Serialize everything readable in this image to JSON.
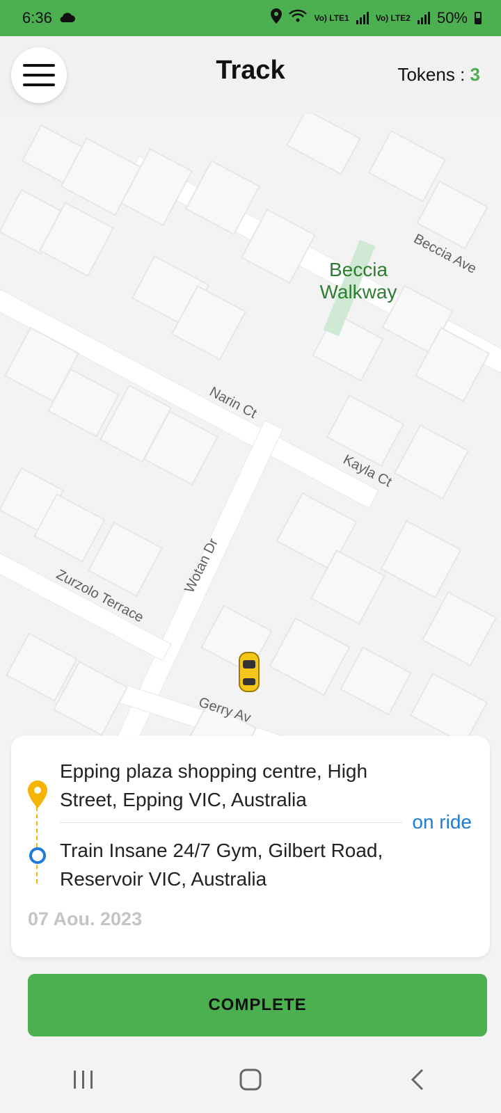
{
  "status_bar": {
    "time": "6:36",
    "lte1": "Vo) LTE1",
    "lte2": "Vo) LTE2",
    "battery": "50%"
  },
  "header": {
    "title": "Track",
    "tokens_label": "Tokens : ",
    "tokens_value": "3"
  },
  "map": {
    "place": "Beccia Walkway",
    "roads": [
      "Beccia Ave",
      "Narin Ct",
      "Kayla Ct",
      "Wotan Dr",
      "Zurzolo Terrace",
      "Gerry Av"
    ]
  },
  "trip": {
    "pickup": "Epping plaza shopping centre, High Street, Epping VIC, Australia",
    "dropoff": "Train Insane 24/7 Gym, Gilbert Road, Reservoir VIC, Australia",
    "status": "on ride",
    "date": "07 Aou. 2023"
  },
  "actions": {
    "complete": "COMPLETE"
  },
  "colors": {
    "brand": "#4caf50",
    "status_blue": "#1e7bd8",
    "pin_yellow": "#f5b400"
  }
}
